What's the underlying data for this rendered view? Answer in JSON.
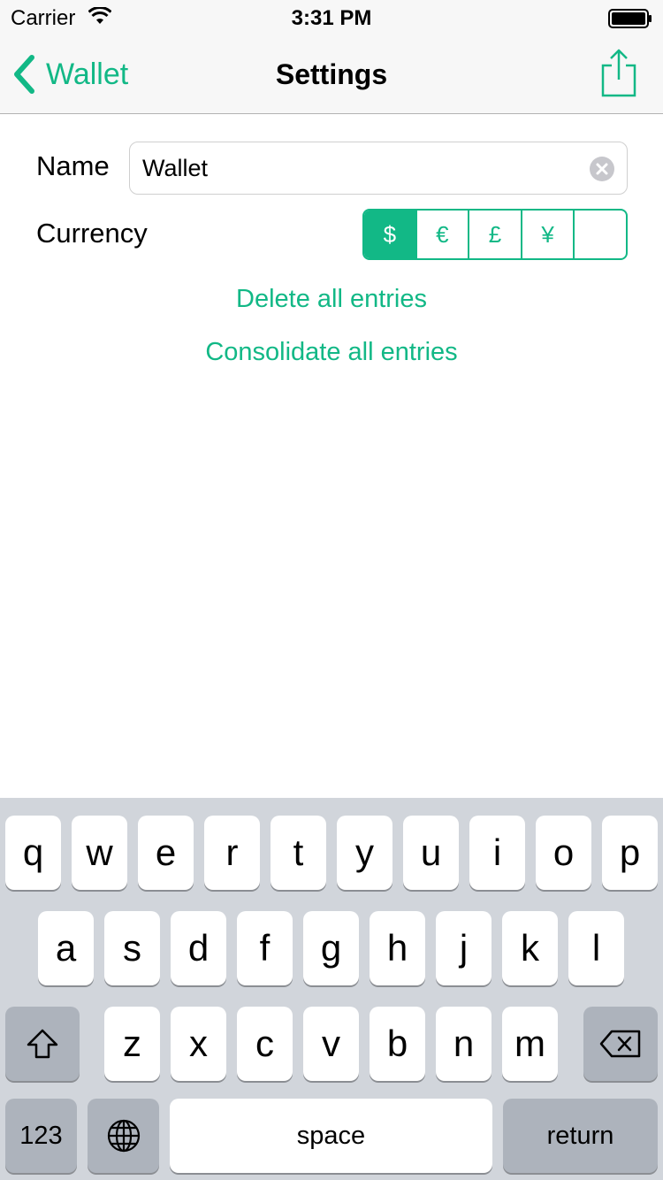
{
  "status_bar": {
    "carrier": "Carrier",
    "time": "3:31 PM"
  },
  "nav": {
    "back_label": "Wallet",
    "title": "Settings"
  },
  "form": {
    "name_label": "Name",
    "name_value": "Wallet",
    "currency_label": "Currency",
    "currencies": [
      "$",
      "€",
      "£",
      "¥",
      ""
    ],
    "selected_currency": "$"
  },
  "actions": {
    "delete_all": "Delete all entries",
    "consolidate_all": "Consolidate all entries"
  },
  "keyboard": {
    "row1": [
      "q",
      "w",
      "e",
      "r",
      "t",
      "y",
      "u",
      "i",
      "o",
      "p"
    ],
    "row2": [
      "a",
      "s",
      "d",
      "f",
      "g",
      "h",
      "j",
      "k",
      "l"
    ],
    "row3": [
      "z",
      "x",
      "c",
      "v",
      "b",
      "n",
      "m"
    ],
    "numbers_label": "123",
    "space_label": "space",
    "return_label": "return"
  },
  "colors": {
    "accent": "#12b886",
    "keyboard_bg": "#d1d5db",
    "dark_key": "#adb3bc"
  }
}
